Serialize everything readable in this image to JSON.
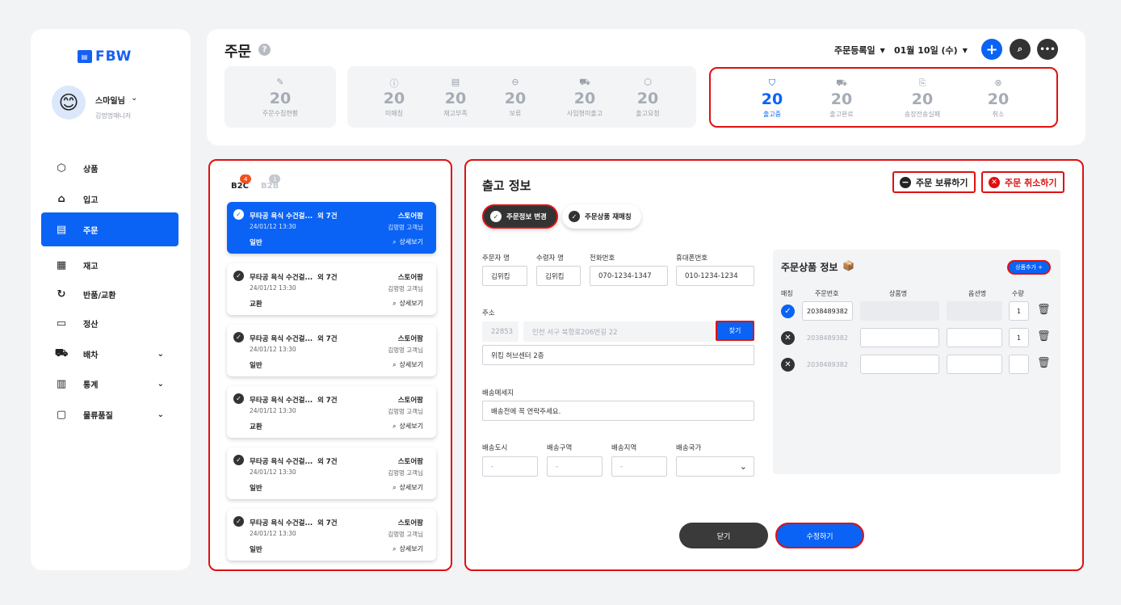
{
  "brand": {
    "logo": "FBW",
    "accent": "#0a63f5",
    "highlight": "#e01010"
  },
  "user": {
    "name": "스마일님",
    "role": "김멍멍매니저",
    "avatar": "☺"
  },
  "nav": [
    {
      "label": "상품",
      "icon": "cube-icon",
      "active": false
    },
    {
      "label": "입고",
      "icon": "warehouse-icon",
      "active": false
    },
    {
      "label": "주문",
      "icon": "order-icon",
      "active": true
    },
    {
      "label": "재고",
      "icon": "grid-icon",
      "active": false
    },
    {
      "label": "반품/교환",
      "icon": "exchange-icon",
      "active": false
    },
    {
      "label": "정산",
      "icon": "card-icon",
      "active": false
    },
    {
      "label": "배차",
      "icon": "car-icon",
      "active": false,
      "expand": true
    },
    {
      "label": "통계",
      "icon": "chart-icon",
      "active": false,
      "expand": true
    },
    {
      "label": "물류품질",
      "icon": "chat-icon",
      "active": false,
      "expand": true
    }
  ],
  "header": {
    "title": "주문",
    "help": "?",
    "date_type": "주문등록일",
    "date": "01월 10일 (수)"
  },
  "stats": {
    "group1": [
      {
        "label": "주문수집현황",
        "value": "20"
      }
    ],
    "group2": [
      {
        "label": "미매칭",
        "value": "20"
      },
      {
        "label": "재고부족",
        "value": "20"
      },
      {
        "label": "보류",
        "value": "20"
      },
      {
        "label": "사입형미출고",
        "value": "20"
      },
      {
        "label": "출고요청",
        "value": "20"
      }
    ],
    "group3": [
      {
        "label": "출고중",
        "value": "20",
        "active": true
      },
      {
        "label": "출고완료",
        "value": "20"
      },
      {
        "label": "송장전송실패",
        "value": "20"
      },
      {
        "label": "취소",
        "value": "20"
      }
    ]
  },
  "order_list": {
    "tabs": [
      {
        "label": "B2C",
        "count": "4"
      },
      {
        "label": "B2B",
        "count": "1"
      }
    ],
    "orders": [
      {
        "title": "무타공 욕식 수건걸...",
        "more": "외 7건",
        "store": "스토어팜",
        "date": "24/01/12 13:30",
        "customer": "김멍멍 고객님",
        "type": "일반",
        "detail": "상세보기",
        "active": true
      },
      {
        "title": "무타공 욕식 수건걸...",
        "more": "외 7건",
        "store": "스토어팜",
        "date": "24/01/12 13:30",
        "customer": "김멍멍 고객님",
        "type": "교환",
        "detail": "상세보기"
      },
      {
        "title": "무타공 욕식 수건걸...",
        "more": "외 7건",
        "store": "스토어팜",
        "date": "24/01/12 13:30",
        "customer": "김멍멍 고객님",
        "type": "일반",
        "detail": "상세보기"
      },
      {
        "title": "무타공 욕식 수건걸...",
        "more": "외 7건",
        "store": "스토어팜",
        "date": "24/01/12 13:30",
        "customer": "김멍멍 고객님",
        "type": "교환",
        "detail": "상세보기"
      },
      {
        "title": "무타공 욕식 수건걸...",
        "more": "외 7건",
        "store": "스토어팜",
        "date": "24/01/12 13:30",
        "customer": "김멍멍 고객님",
        "type": "일반",
        "detail": "상세보기"
      },
      {
        "title": "무타공 욕식 수건걸...",
        "more": "외 7건",
        "store": "스토어팜",
        "date": "24/01/12 13:30",
        "customer": "김멍멍 고객님",
        "type": "일반",
        "detail": "상세보기"
      }
    ]
  },
  "detail": {
    "title": "출고 정보",
    "hold_btn": "주문 보류하기",
    "cancel_btn": "주문 취소하기",
    "tab_edit": "주문정보 변경",
    "tab_rematch": "주문상품 재매칭",
    "fields": {
      "orderer_label": "주문자 명",
      "orderer": "김위킴",
      "receiver_label": "수령자 명",
      "receiver": "김위킴",
      "phone_label": "전화번호",
      "phone": "070-1234-1347",
      "mobile_label": "휴대폰번호",
      "mobile": "010-1234-1234",
      "address_label": "주소",
      "zip": "22853",
      "address": "인천 서구 북항로206번길 22",
      "find_btn": "찾기",
      "address_detail": "위킴 허브센터 2층",
      "message_label": "배송메세지",
      "message": "배송전에 꼭 연락주세요.",
      "city_label": "배송도시",
      "city": "-",
      "zone_label": "배송구역",
      "zone": "-",
      "region_label": "배송지역",
      "region": "-",
      "country_label": "배송국가",
      "country": ""
    },
    "products": {
      "title": "주문상품 정보",
      "emoji": "📦",
      "add_btn": "상품추가 +",
      "headers": [
        "매칭",
        "주문번호",
        "상품명",
        "옵션명",
        "수량"
      ],
      "rows": [
        {
          "matched": true,
          "order_no": "2038489382",
          "qty": "1"
        },
        {
          "matched": false,
          "order_no": "2038489382",
          "qty": "1"
        },
        {
          "matched": false,
          "order_no": "2038489382",
          "qty": ""
        }
      ]
    },
    "close_btn": "닫기",
    "save_btn": "수정하기"
  }
}
